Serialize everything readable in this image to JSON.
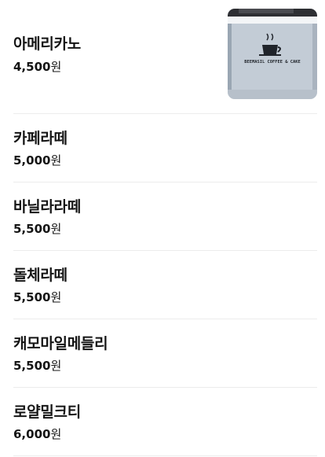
{
  "menu": {
    "currency": "원",
    "items": [
      {
        "name": "아메리카노",
        "price": "4,500",
        "has_image": true
      },
      {
        "name": "카페라떼",
        "price": "5,000"
      },
      {
        "name": "바닐라라떼",
        "price": "5,500"
      },
      {
        "name": "돌체라떼",
        "price": "5,500"
      },
      {
        "name": "캐모마일메들리",
        "price": "5,500"
      },
      {
        "name": "로얄밀크티",
        "price": "6,000"
      }
    ],
    "thumbnail_sign_text": "BEEMASIL COFFEE & CAKE"
  }
}
